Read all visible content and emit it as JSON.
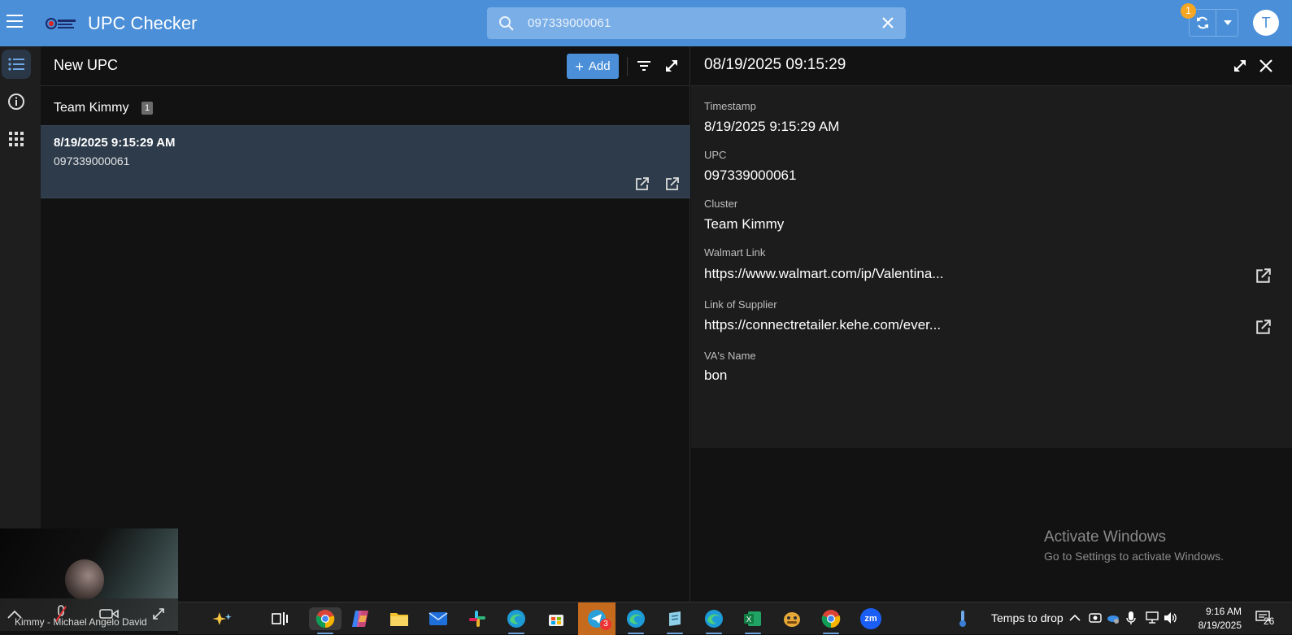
{
  "header": {
    "app_title": "UPC Checker",
    "search_value": "097339000061",
    "sync_badge": "1",
    "avatar_initial": "T"
  },
  "list": {
    "title": "New UPC",
    "add_label": "Add",
    "group": {
      "name": "Team Kimmy",
      "count": "1"
    },
    "rows": [
      {
        "timestamp": "8/19/2025 9:15:29 AM",
        "upc": "097339000061"
      }
    ]
  },
  "detail": {
    "title": "08/19/2025 09:15:29",
    "fields": [
      {
        "label": "Timestamp",
        "value": "8/19/2025 9:15:29 AM"
      },
      {
        "label": "UPC",
        "value": "097339000061"
      },
      {
        "label": "Cluster",
        "value": "Team Kimmy"
      },
      {
        "label": "Walmart Link",
        "value": "https://www.walmart.com/ip/Valentina..."
      },
      {
        "label": "Link of Supplier",
        "value": "https://connectretailer.kehe.com/ever..."
      },
      {
        "label": "VA's Name",
        "value": "bon"
      }
    ]
  },
  "watermark": {
    "title": "Activate Windows",
    "subtitle": "Go to Settings to activate Windows."
  },
  "video": {
    "caption": "Kimmy - Michael Angelo David"
  },
  "taskbar": {
    "weather": "Temps to drop",
    "time": "9:16 AM",
    "date": "8/19/2025",
    "telegram_badge": "3",
    "notification_count": "26",
    "zoom_label": "zm"
  },
  "colors": {
    "accent": "#4a8fd8",
    "badge": "#f5a623",
    "row_selected": "#2d3b4b"
  }
}
